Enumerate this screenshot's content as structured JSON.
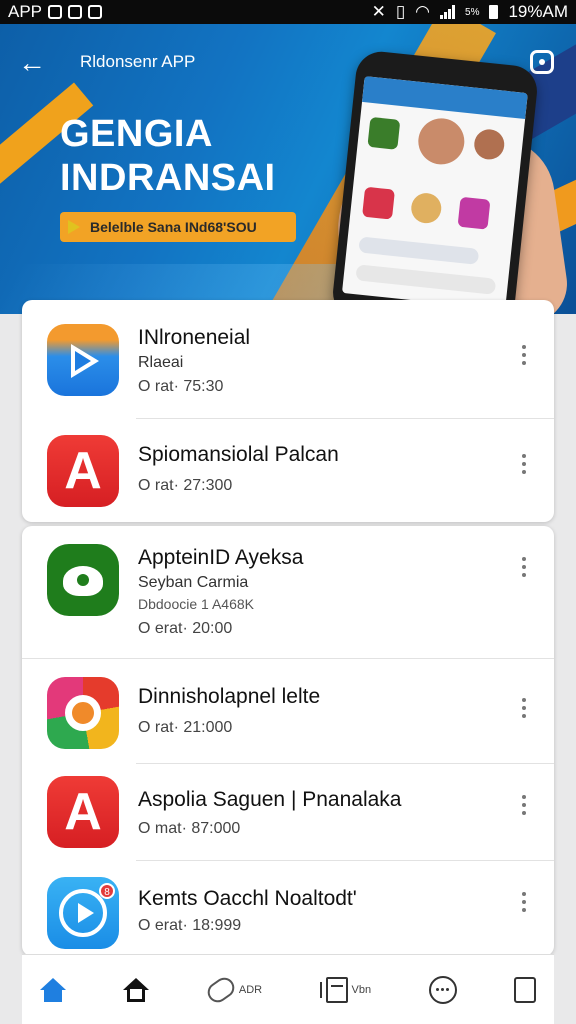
{
  "status_bar": {
    "left_text": "APP",
    "battery_text": "5%",
    "time": "19%AM"
  },
  "hero": {
    "app_name": "Rldonsenr APP",
    "title_line1": "GENGIA",
    "title_line2": "INDRANSAI",
    "cta_label": "Belelble Sana INd68'SOU",
    "colors": {
      "primary": "#1273c2",
      "accent": "#f2a325"
    }
  },
  "apps": [
    {
      "name": "INlroneneial",
      "subtitle": "Rlaeai",
      "meta": "O rat·  75:30",
      "icon": "play-triangle-icon"
    },
    {
      "name": "Spiomansiolal Palcan",
      "meta": "O rat·  27:300",
      "icon": "letter-a-icon",
      "icon_letter": "A"
    },
    {
      "name": "AppteinID Ayeksa",
      "subtitle": "Seyban Carmia",
      "subtitle2": "Dbdoocie 1 A468K",
      "meta": "O erat·  20:00",
      "icon": "green-blob-icon"
    },
    {
      "name": "Dinnisholapnel lelte",
      "meta": "O rat·  21:000",
      "icon": "multicolor-ring-icon"
    },
    {
      "name": "Aspolia Saguen | Pnanalaka",
      "meta": "O mat·  87:000",
      "icon": "letter-a-icon",
      "icon_letter": "A"
    },
    {
      "name": "Kemts Oacchl Noaltodt'",
      "meta": "O erat·  18:999",
      "icon": "blue-play-circle-icon",
      "badge": "8"
    }
  ],
  "bottom_nav": {
    "clip_label": "ADR",
    "edit_label": "Vbn"
  }
}
